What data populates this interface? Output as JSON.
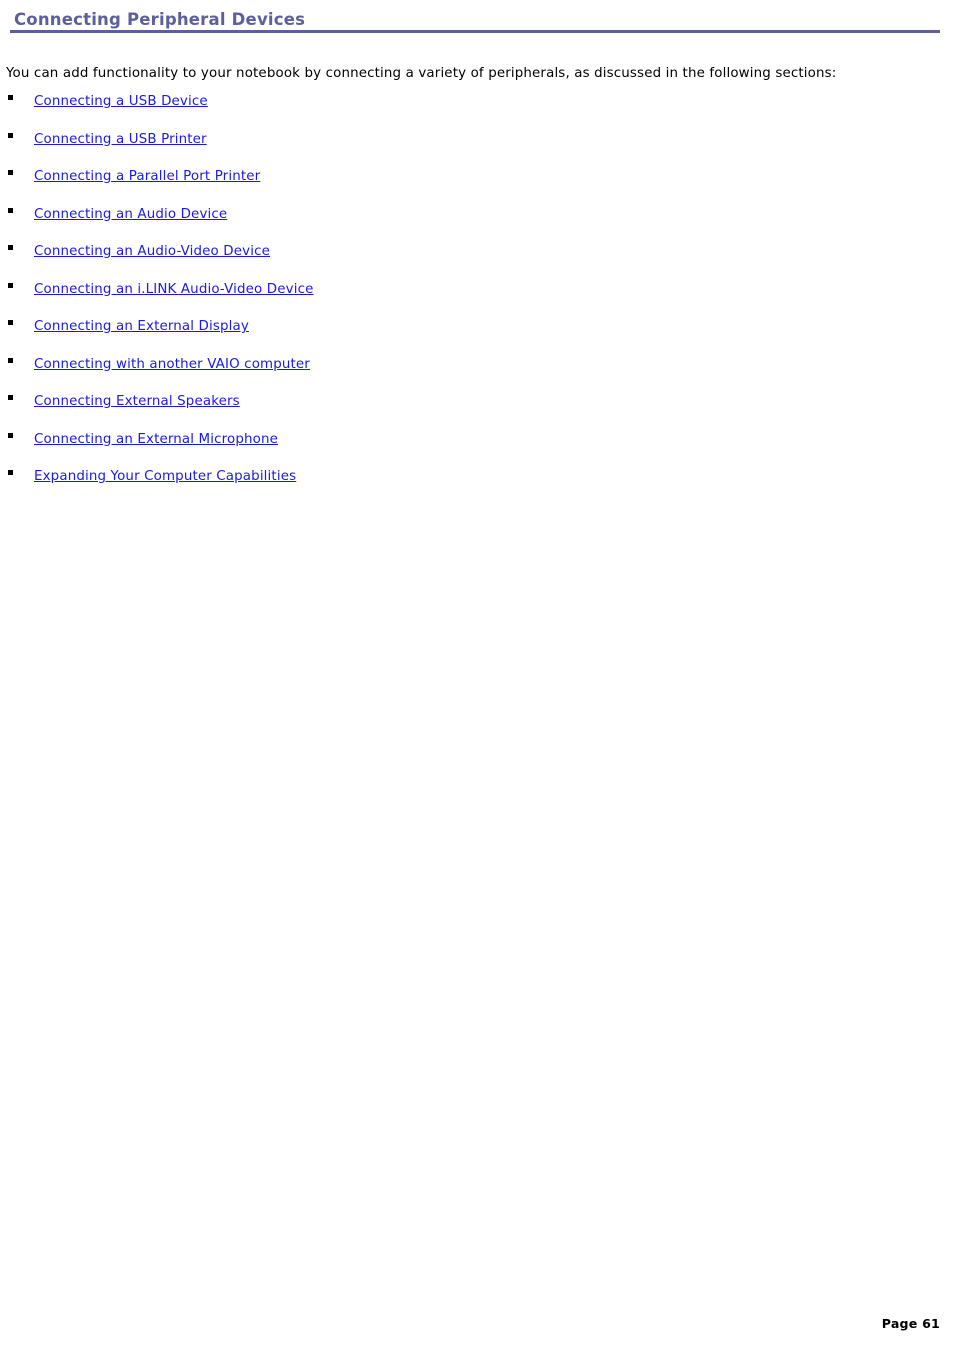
{
  "document": {
    "title": "Connecting Peripheral Devices",
    "intro": "You can add functionality to your notebook by connecting a variety of peripherals, as discussed in the following sections:",
    "accent_color": "#5d5f9d",
    "link_color": "#1a1ae2",
    "text_color": "#000000",
    "background_color": "#ffffff",
    "links": [
      {
        "label": "Connecting a USB Device"
      },
      {
        "label": "Connecting a USB Printer"
      },
      {
        "label": "Connecting a Parallel Port Printer"
      },
      {
        "label": "Connecting an Audio Device"
      },
      {
        "label": "Connecting an Audio-Video Device"
      },
      {
        "label": "Connecting an i.LINK Audio-Video Device"
      },
      {
        "label": "Connecting an External Display"
      },
      {
        "label": "Connecting with another VAIO computer"
      },
      {
        "label": "Connecting External Speakers"
      },
      {
        "label": "Connecting an External Microphone"
      },
      {
        "label": "Expanding Your Computer Capabilities"
      }
    ],
    "footer": {
      "page_number": "Page 61"
    }
  }
}
